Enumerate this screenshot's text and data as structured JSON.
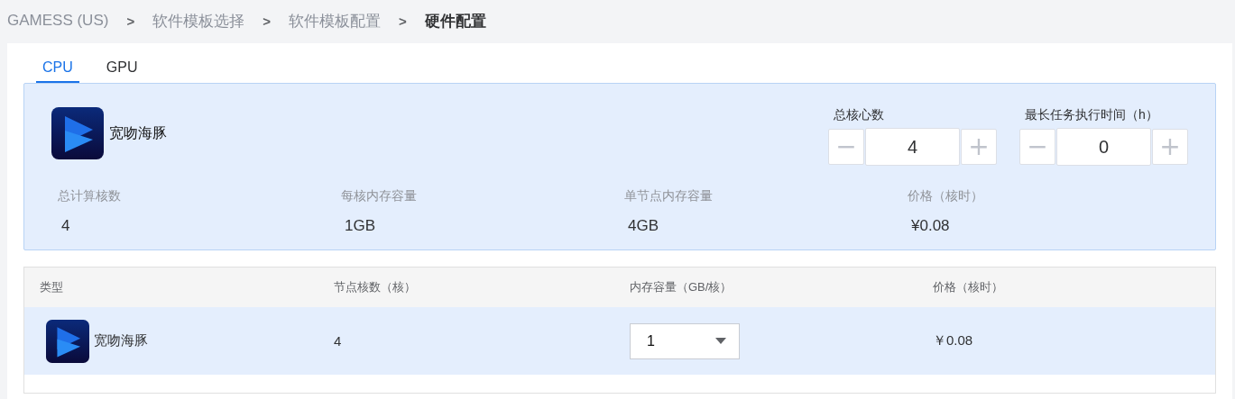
{
  "breadcrumb": [
    {
      "label": "GAMESS (US)",
      "current": false
    },
    {
      "label": "软件模板选择",
      "current": false
    },
    {
      "label": "软件模板配置",
      "current": false
    },
    {
      "label": "硬件配置",
      "current": true
    }
  ],
  "separator": ">",
  "tabs": [
    {
      "label": "CPU",
      "selected": true
    },
    {
      "label": "GPU",
      "selected": false
    }
  ],
  "summary": {
    "name": "宽吻海豚",
    "steppers": [
      {
        "label": "总核心数",
        "value": "4",
        "minus": "−",
        "plus": "+"
      },
      {
        "label": "最长任务执行时间（h）",
        "value": "0",
        "minus": "−",
        "plus": "+"
      }
    ],
    "stats": [
      {
        "label": "总计算核数",
        "value": "4"
      },
      {
        "label": "每核内存容量",
        "value": "1GB"
      },
      {
        "label": "单节点内存容量",
        "value": "4GB"
      },
      {
        "label": "价格（核时）",
        "value": "¥0.08"
      }
    ]
  },
  "table": {
    "columns": [
      "类型",
      "节点核数（核）",
      "内存容量（GB/核）",
      "价格（核时）"
    ],
    "rows": [
      {
        "type": "宽吻海豚",
        "cores": "4",
        "memory": "1",
        "price": "￥0.08",
        "selected": true
      }
    ]
  }
}
